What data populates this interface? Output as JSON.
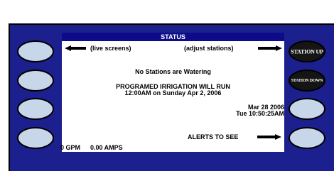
{
  "screen": {
    "title": "STATUS",
    "live_screens": "(live screens)",
    "adjust_stations": "(adjust stations)",
    "no_stations_msg": "No Stations are Watering",
    "programmed_line1": "PROGRAMED  IRRIGATION  WILL  RUN",
    "programmed_line2": "12:00AM  on  Sunday  Apr 2, 2006",
    "date": "Mar  28  2006",
    "time": "Tue  10:50:25AM",
    "alerts": "ALERTS TO SEE",
    "gpm": "0  GPM",
    "amps": "0.00 AMPS"
  },
  "softkeys": {
    "right": [
      "STATION UP",
      "STATION DOWN",
      "",
      ""
    ],
    "left": [
      "",
      "",
      "",
      ""
    ]
  },
  "colors": {
    "frame": "#1c1f8e",
    "title_bar": "#0c0c8a",
    "softkey_light": "#c8d6ea",
    "softkey_dark": "#151515"
  }
}
